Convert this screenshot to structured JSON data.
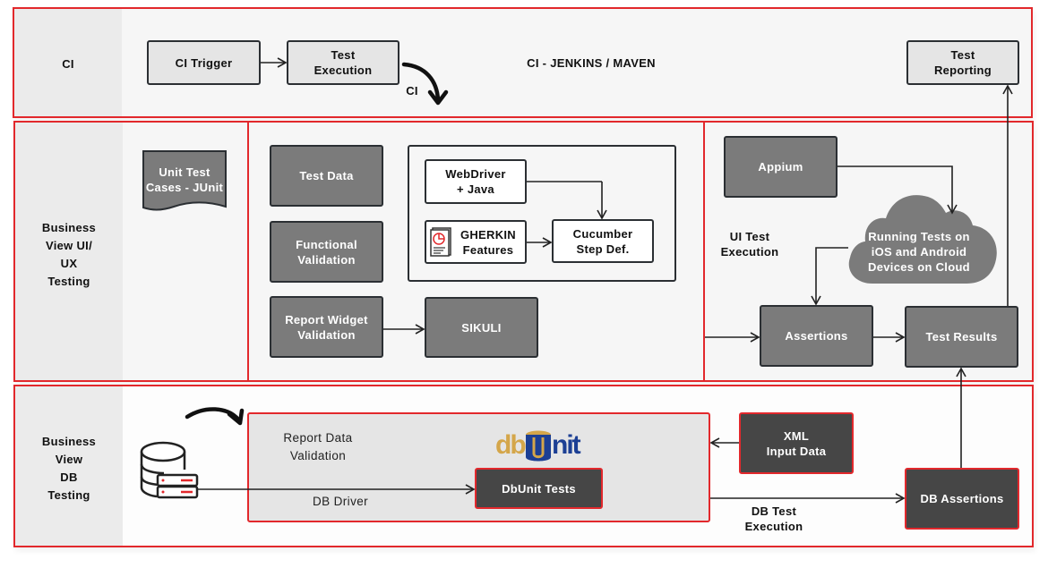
{
  "lanes": {
    "ci": {
      "label": "CI",
      "title": "CI - JENKINS / MAVEN",
      "ci_trigger": "CI Trigger",
      "test_execution": "Test\nExecution",
      "test_reporting": "Test\nReporting",
      "arrow_label": "CI"
    },
    "ui": {
      "label": "Business\nView UI/\nUX\nTesting",
      "unit_test_cases": "Unit Test\nCases - JUnit",
      "test_data": "Test Data",
      "functional_validation": "Functional\nValidation",
      "report_widget_validation": "Report Widget\nValidation",
      "sikuli": "SIKULI",
      "webdriver_java": "WebDriver\n+ Java",
      "gherkin_features": "GHERKIN\nFeatures",
      "cucumber_step_def": "Cucumber\nStep Def.",
      "ui_test_execution": "UI Test\nExecution",
      "appium": "Appium",
      "cloud_devices": "Running Tests on\niOS and Android\nDevices on Cloud",
      "assertions": "Assertions",
      "test_results": "Test Results"
    },
    "db": {
      "label": "Business\nView\nDB\nTesting",
      "report_data_validation": "Report Data\nValidation",
      "db_driver": "DB Driver",
      "dbunit_logo_left": "db",
      "dbunit_logo_right": "nit",
      "dbunit_tests": "DbUnit Tests",
      "xml_input_data": "XML\nInput Data",
      "db_test_execution": "DB Test\nExecution",
      "db_assertions": "DB Assertions"
    }
  },
  "icons": {
    "gherkin": "document-chart-icon",
    "database": "database-server-icon",
    "curved_arrow": "curved-arrow-icon"
  },
  "colors": {
    "accent_red": "#e2282c",
    "box_mid": "#7b7b7b",
    "box_dark": "#464646",
    "box_light": "#e5e5e5",
    "logo_gold": "#d4a64a",
    "logo_blue": "#1c3f94"
  }
}
